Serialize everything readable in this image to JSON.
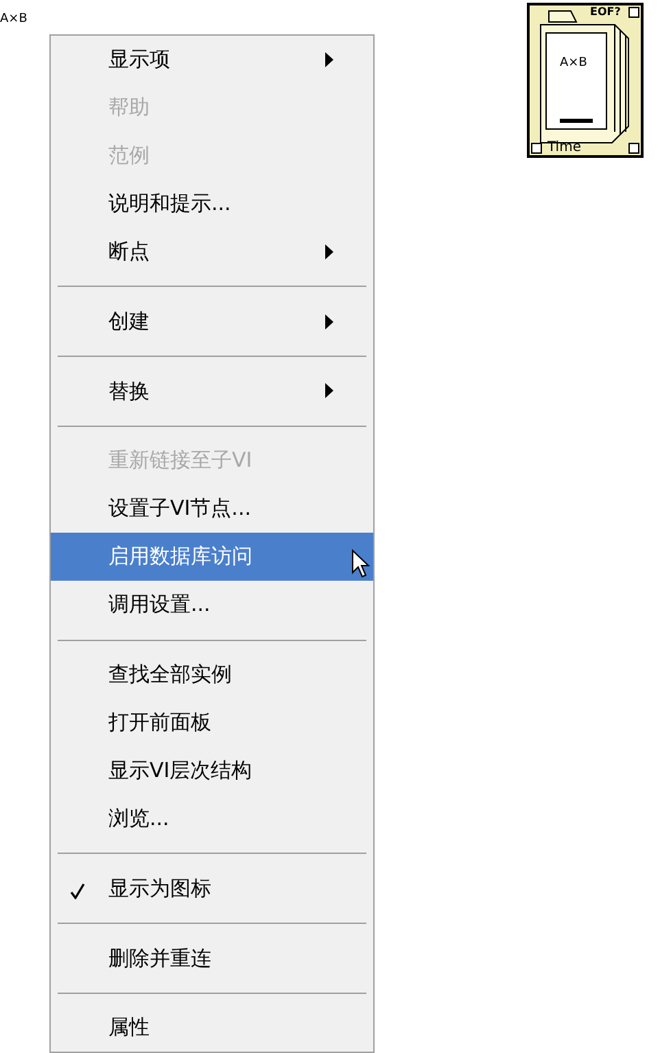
{
  "node_label": "A×B",
  "context_menu": [
    {
      "kind": "item",
      "label": "显示项",
      "submenu": true,
      "disabled": false,
      "selected": false,
      "checked": false
    },
    {
      "kind": "item",
      "label": "帮助",
      "submenu": false,
      "disabled": true,
      "selected": false,
      "checked": false
    },
    {
      "kind": "item",
      "label": "范例",
      "submenu": false,
      "disabled": true,
      "selected": false,
      "checked": false
    },
    {
      "kind": "item",
      "label": "说明和提示...",
      "submenu": false,
      "disabled": false,
      "selected": false,
      "checked": false
    },
    {
      "kind": "item",
      "label": "断点",
      "submenu": true,
      "disabled": false,
      "selected": false,
      "checked": false
    },
    {
      "kind": "separator"
    },
    {
      "kind": "item",
      "label": "创建",
      "submenu": true,
      "disabled": false,
      "selected": false,
      "checked": false
    },
    {
      "kind": "separator"
    },
    {
      "kind": "item",
      "label": "替换",
      "submenu": true,
      "disabled": false,
      "selected": false,
      "checked": false
    },
    {
      "kind": "separator"
    },
    {
      "kind": "item",
      "label": "重新链接至子VI",
      "submenu": false,
      "disabled": true,
      "selected": false,
      "checked": false
    },
    {
      "kind": "item",
      "label": "设置子VI节点...",
      "submenu": false,
      "disabled": false,
      "selected": false,
      "checked": false
    },
    {
      "kind": "item",
      "label": "启用数据库访问",
      "submenu": false,
      "disabled": false,
      "selected": true,
      "checked": false
    },
    {
      "kind": "item",
      "label": "调用设置...",
      "submenu": false,
      "disabled": false,
      "selected": false,
      "checked": false
    },
    {
      "kind": "separator"
    },
    {
      "kind": "item",
      "label": "查找全部实例",
      "submenu": false,
      "disabled": false,
      "selected": false,
      "checked": false
    },
    {
      "kind": "item",
      "label": "打开前面板",
      "submenu": false,
      "disabled": false,
      "selected": false,
      "checked": false
    },
    {
      "kind": "item",
      "label": "显示VI层次结构",
      "submenu": false,
      "disabled": false,
      "selected": false,
      "checked": false
    },
    {
      "kind": "item",
      "label": "浏览...",
      "submenu": false,
      "disabled": false,
      "selected": false,
      "checked": false
    },
    {
      "kind": "separator"
    },
    {
      "kind": "item",
      "label": "显示为图标",
      "submenu": false,
      "disabled": false,
      "selected": false,
      "checked": true
    },
    {
      "kind": "separator"
    },
    {
      "kind": "item",
      "label": "删除并重连",
      "submenu": false,
      "disabled": false,
      "selected": false,
      "checked": false
    },
    {
      "kind": "separator"
    },
    {
      "kind": "item",
      "label": "属性",
      "submenu": false,
      "disabled": false,
      "selected": false,
      "checked": false
    }
  ],
  "subvi_icon": {
    "top_label": "EOF?",
    "center_label": "A×B",
    "bottom_label": "Time"
  }
}
